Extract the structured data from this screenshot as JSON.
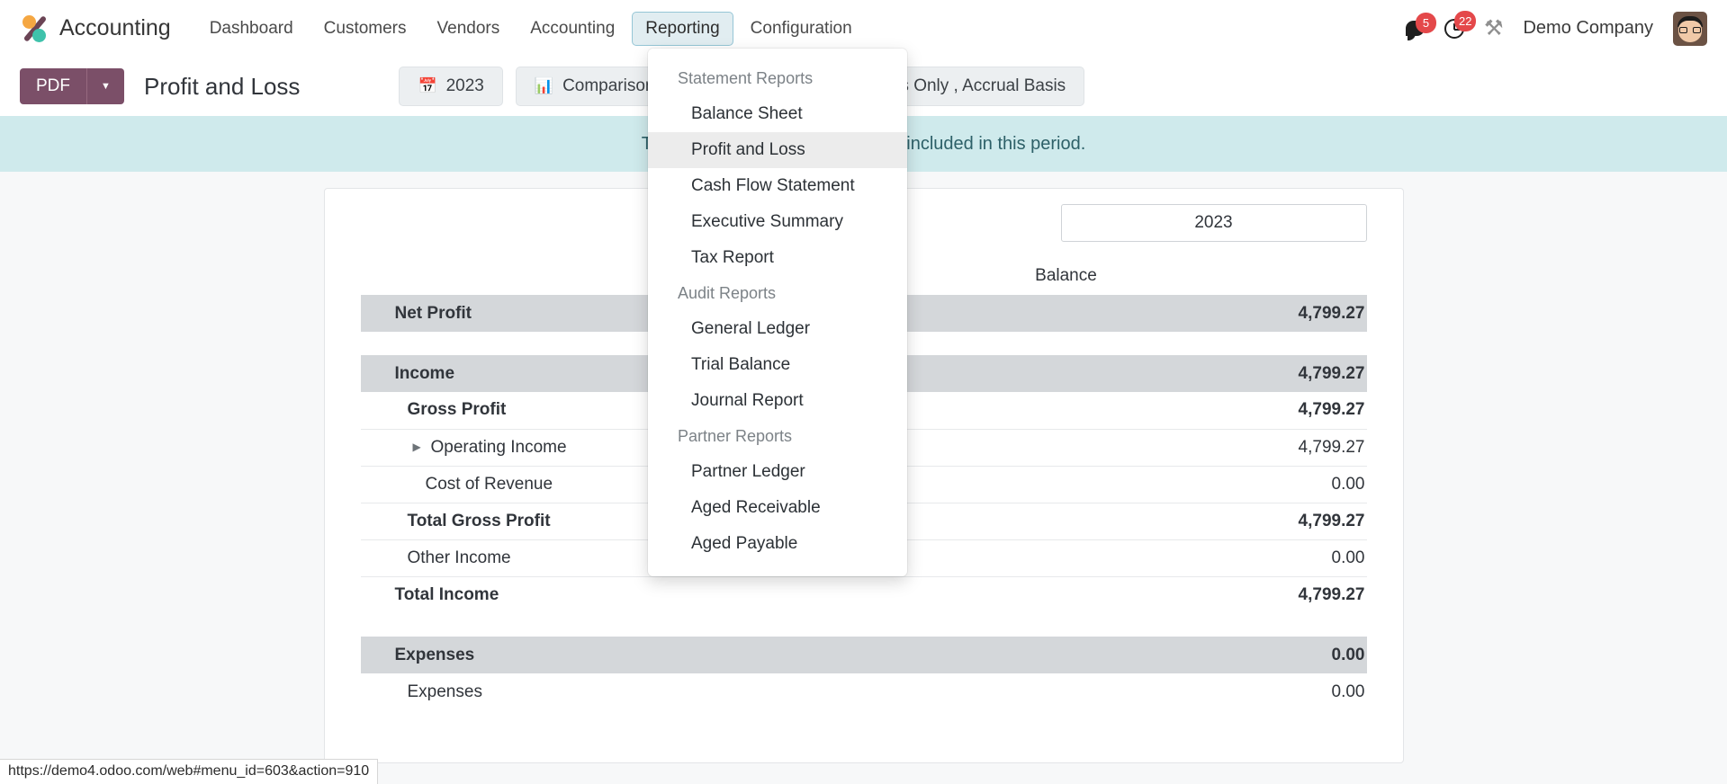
{
  "navbar": {
    "brand": "Accounting",
    "menu": [
      {
        "label": "Dashboard",
        "active": false
      },
      {
        "label": "Customers",
        "active": false
      },
      {
        "label": "Vendors",
        "active": false
      },
      {
        "label": "Accounting",
        "active": false
      },
      {
        "label": "Reporting",
        "active": true
      },
      {
        "label": "Configuration",
        "active": false
      }
    ],
    "messages_badge": "5",
    "activities_badge": "22",
    "company": "Demo Company",
    "icons": {
      "messages": "chat-bubble-icon",
      "activities": "clock-icon",
      "tools": "tools-icon",
      "avatar": "user-avatar"
    }
  },
  "controlbar": {
    "pdf_label": "PDF",
    "pdf_caret": "▾",
    "page_title": "Profit and Loss",
    "filters": [
      {
        "icon": "calendar-icon",
        "glyph": "📅",
        "label": "2023"
      },
      {
        "icon": "chart-bar-icon",
        "glyph": "📊",
        "label": "Comparison"
      },
      {
        "icon": "funnel-icon",
        "glyph": "▼",
        "label": "Options: Posted Entries Only , Accrual Basis"
      }
    ]
  },
  "banner": {
    "text": "There are draft entries prior to or included in this period."
  },
  "dropdown": {
    "groups": [
      {
        "title": "Statement Reports",
        "items": [
          {
            "label": "Balance Sheet",
            "selected": false
          },
          {
            "label": "Profit and Loss",
            "selected": true
          },
          {
            "label": "Cash Flow Statement",
            "selected": false
          },
          {
            "label": "Executive Summary",
            "selected": false
          },
          {
            "label": "Tax Report",
            "selected": false
          }
        ]
      },
      {
        "title": "Audit Reports",
        "items": [
          {
            "label": "General Ledger",
            "selected": false
          },
          {
            "label": "Trial Balance",
            "selected": false
          },
          {
            "label": "Journal Report",
            "selected": false
          }
        ]
      },
      {
        "title": "Partner Reports",
        "items": [
          {
            "label": "Partner Ledger",
            "selected": false
          },
          {
            "label": "Aged Receivable",
            "selected": false
          },
          {
            "label": "Aged Payable",
            "selected": false
          }
        ]
      }
    ]
  },
  "report": {
    "period_label": "2023",
    "column_header": "Balance",
    "rows": [
      {
        "label": "Net Profit",
        "value": "4,799.27",
        "indent": 0,
        "bold": true,
        "shaded": true,
        "muted": false,
        "caret": false,
        "topline": false
      },
      {
        "label": "",
        "value": "",
        "indent": 0,
        "bold": false,
        "shaded": false,
        "muted": false,
        "caret": false,
        "topline": false,
        "spacer": true
      },
      {
        "label": "Income",
        "value": "4,799.27",
        "indent": 0,
        "bold": true,
        "shaded": true,
        "muted": false,
        "caret": false,
        "topline": false
      },
      {
        "label": "Gross Profit",
        "value": "4,799.27",
        "indent": 1,
        "bold": true,
        "shaded": false,
        "muted": false,
        "caret": false,
        "topline": false
      },
      {
        "label": "Operating Income",
        "value": "4,799.27",
        "indent": 2,
        "bold": false,
        "shaded": false,
        "muted": false,
        "caret": true,
        "topline": true
      },
      {
        "label": "Cost of Revenue",
        "value": "0.00",
        "indent": 2,
        "bold": false,
        "shaded": false,
        "muted": true,
        "caret": false,
        "topline": true
      },
      {
        "label": "Total Gross Profit",
        "value": "4,799.27",
        "indent": 1,
        "bold": true,
        "shaded": false,
        "muted": false,
        "caret": false,
        "topline": true
      },
      {
        "label": "Other Income",
        "value": "0.00",
        "indent": 1,
        "bold": false,
        "shaded": false,
        "muted": true,
        "caret": false,
        "topline": true
      },
      {
        "label": "Total Income",
        "value": "4,799.27",
        "indent": 0,
        "bold": true,
        "shaded": false,
        "muted": false,
        "caret": false,
        "topline": true
      },
      {
        "label": "",
        "value": "",
        "indent": 0,
        "bold": false,
        "shaded": false,
        "muted": false,
        "caret": false,
        "topline": true,
        "spacer": true
      },
      {
        "label": "Expenses",
        "value": "0.00",
        "indent": 0,
        "bold": true,
        "shaded": true,
        "muted": true,
        "caret": false,
        "topline": false
      },
      {
        "label": "Expenses",
        "value": "0.00",
        "indent": 1,
        "bold": false,
        "shaded": false,
        "muted": true,
        "caret": false,
        "topline": false
      }
    ]
  },
  "statusbar": {
    "url": "https://demo4.odoo.com/web#menu_id=603&action=910"
  }
}
